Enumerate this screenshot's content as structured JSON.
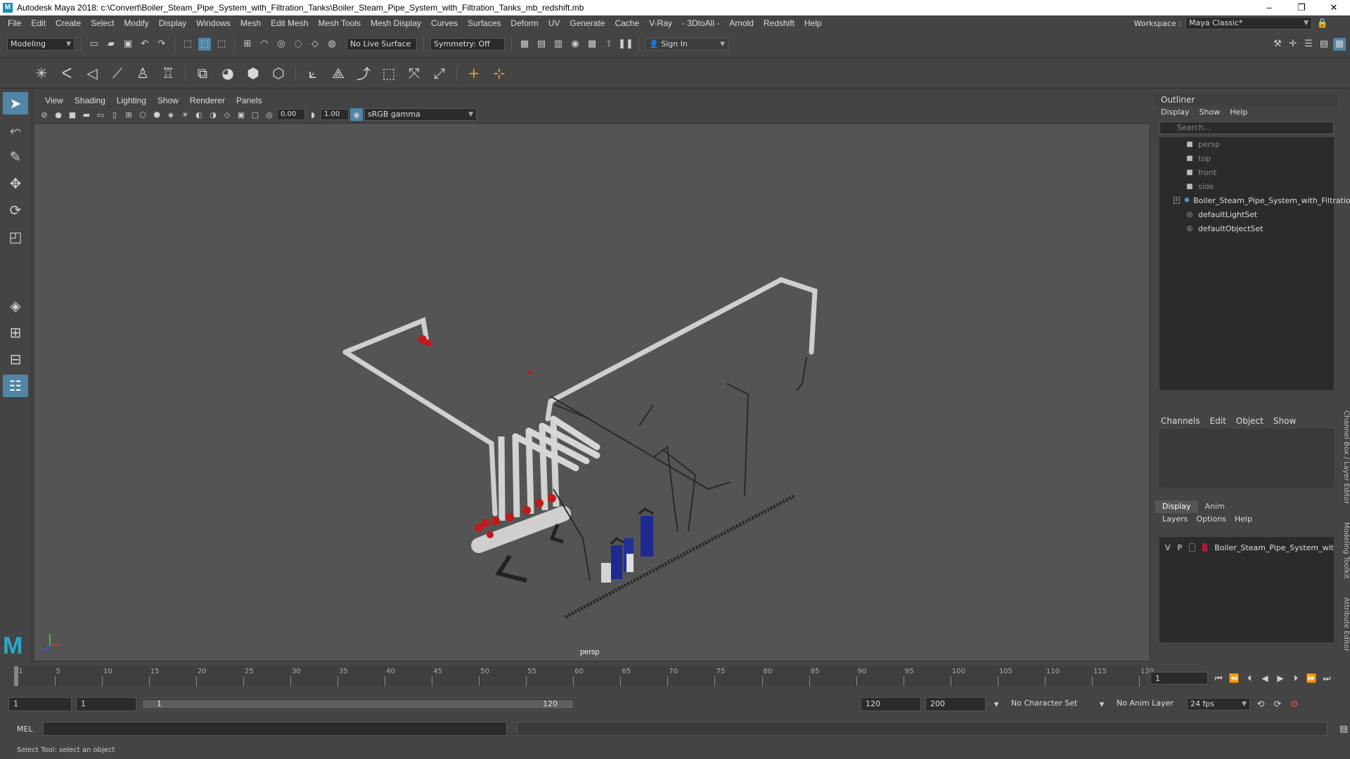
{
  "window": {
    "title": "Autodesk Maya 2018: c:\\Convert\\Boiler_Steam_Pipe_System_with_Filtration_Tanks\\Boiler_Steam_Pipe_System_with_Filtration_Tanks_mb_redshift.mb",
    "controls": [
      "–",
      "❐",
      "✕"
    ]
  },
  "menu": {
    "items": [
      "File",
      "Edit",
      "Create",
      "Select",
      "Modify",
      "Display",
      "Windows",
      "Mesh",
      "Edit Mesh",
      "Mesh Tools",
      "Mesh Display",
      "Curves",
      "Surfaces",
      "Deform",
      "UV",
      "Generate",
      "Cache",
      "V-Ray",
      "- 3DtoAll -",
      "Arnold",
      "Redshift",
      "Help"
    ],
    "workspace_label": "Workspace :",
    "workspace_value": "Maya Classic*"
  },
  "statusline": {
    "mode": "Modeling",
    "live_surface": "No Live Surface",
    "symmetry": "Symmetry: Off",
    "sign_in": "Sign In"
  },
  "panel": {
    "menus": [
      "View",
      "Shading",
      "Lighting",
      "Show",
      "Renderer",
      "Panels"
    ],
    "exposure": "0.00",
    "gamma": "1.00",
    "colorspace": "sRGB gamma",
    "camera_label": "persp"
  },
  "outliner": {
    "title": "Outliner",
    "menus": [
      "Display",
      "Show",
      "Help"
    ],
    "search_placeholder": "Search...",
    "items": [
      {
        "label": "persp",
        "icon": "camera-icon",
        "dim": true
      },
      {
        "label": "top",
        "icon": "camera-icon",
        "dim": true
      },
      {
        "label": "front",
        "icon": "camera-icon",
        "dim": true
      },
      {
        "label": "side",
        "icon": "camera-icon",
        "dim": true
      },
      {
        "label": "Boiler_Steam_Pipe_System_with_Filtratio",
        "icon": "group-icon",
        "dim": false
      },
      {
        "label": "defaultLightSet",
        "icon": "set-icon",
        "dim": false
      },
      {
        "label": "defaultObjectSet",
        "icon": "set-icon",
        "dim": false
      }
    ]
  },
  "channelbox": {
    "menus": [
      "Channels",
      "Edit",
      "Object",
      "Show"
    ]
  },
  "layers": {
    "tabs": [
      "Display",
      "Anim"
    ],
    "menus": [
      "Layers",
      "Options",
      "Help"
    ],
    "row": {
      "v": "V",
      "p": "P",
      "name": "Boiler_Steam_Pipe_System_wit",
      "color": "#b0163a"
    }
  },
  "sidetabs": [
    "Channel Box / Layer Editor",
    "Modeling Toolkit",
    "Attribute Editor"
  ],
  "timeline": {
    "ticks": [
      1,
      5,
      10,
      15,
      20,
      25,
      30,
      35,
      40,
      45,
      50,
      55,
      60,
      65,
      70,
      75,
      80,
      85,
      90,
      95,
      100,
      105,
      110,
      115,
      120
    ],
    "current_frame": "1"
  },
  "range": {
    "start": "1",
    "inner_start": "1",
    "bar_start": "1",
    "bar_end": "120",
    "end": "120",
    "anim_end": "200",
    "character_set": "No Character Set",
    "anim_layer": "No Anim Layer",
    "fps": "24 fps"
  },
  "cmdline": {
    "lang": "MEL"
  },
  "helpline": "Select Tool: select an object"
}
